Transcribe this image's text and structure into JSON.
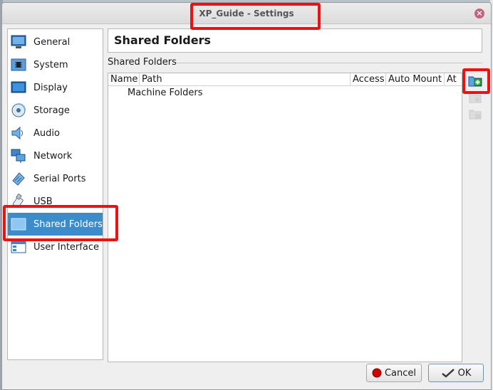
{
  "window": {
    "title": "XP_Guide - Settings"
  },
  "sidebar": {
    "items": [
      {
        "label": "General",
        "icon": "general-icon"
      },
      {
        "label": "System",
        "icon": "system-icon"
      },
      {
        "label": "Display",
        "icon": "display-icon"
      },
      {
        "label": "Storage",
        "icon": "storage-icon"
      },
      {
        "label": "Audio",
        "icon": "audio-icon"
      },
      {
        "label": "Network",
        "icon": "network-icon"
      },
      {
        "label": "Serial Ports",
        "icon": "serial-ports-icon"
      },
      {
        "label": "USB",
        "icon": "usb-icon"
      },
      {
        "label": "Shared Folders",
        "icon": "shared-folders-icon",
        "selected": true
      },
      {
        "label": "User Interface",
        "icon": "user-interface-icon"
      }
    ]
  },
  "page": {
    "title": "Shared Folders",
    "group_label": "Shared Folders",
    "table": {
      "columns": [
        "Name",
        "Path",
        "Access",
        "Auto Mount",
        "At"
      ],
      "rows": [
        {
          "label": "Machine Folders"
        }
      ]
    },
    "tools": [
      "add-shared-folder-icon",
      "edit-shared-folder-icon",
      "remove-shared-folder-icon"
    ]
  },
  "buttons": {
    "cancel": "Cancel",
    "ok": "OK"
  },
  "colors": {
    "selection": "#3a8dca",
    "highlight": "#ee1111",
    "cancel_icon": "#d40000"
  }
}
